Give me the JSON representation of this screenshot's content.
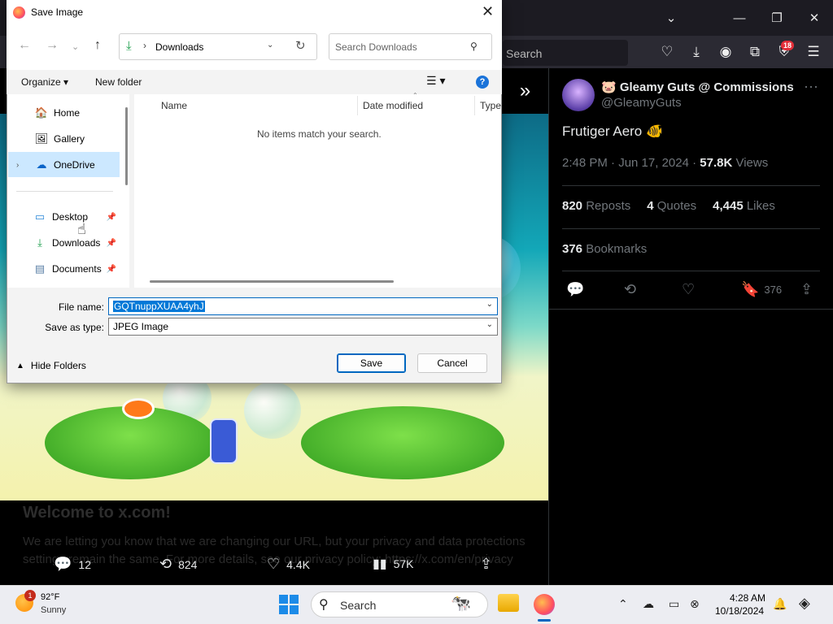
{
  "browser": {
    "search_placeholder": "Search",
    "extension_badge": "18"
  },
  "left": {
    "welcome_title": "Welcome to x.com!",
    "welcome_body": "We are letting you know that we are changing our URL, but your privacy and data protections settings remain the same. For more details, see our privacy policy: https://x.com/en/privacy",
    "actions": {
      "replies": "12",
      "reposts": "824",
      "likes": "4.4K",
      "views": "57K"
    }
  },
  "tweet": {
    "author_name": "🐷 Gleamy Guts @ Commissions ?",
    "author_handle": "@GleamyGuts",
    "text": "Frutiger Aero 🐠",
    "time": "2:48 PM · Jun 17, 2024 ·",
    "views_count": "57.8K",
    "views_label": "Views",
    "reposts_count": "820",
    "reposts_label": "Reposts",
    "quotes_count": "4",
    "quotes_label": "Quotes",
    "likes_count": "4,445",
    "likes_label": "Likes",
    "bookmarks_count": "376",
    "bookmarks_label": "Bookmarks",
    "bookmark_action_count": "376"
  },
  "dialog": {
    "title": "Save Image",
    "address": "Downloads",
    "search_placeholder": "Search Downloads",
    "organize": "Organize ▾",
    "new_folder": "New folder",
    "nav_items": [
      {
        "label": "Home"
      },
      {
        "label": "Gallery"
      },
      {
        "label": "OneDrive"
      },
      {
        "label": "Desktop"
      },
      {
        "label": "Downloads"
      },
      {
        "label": "Documents"
      }
    ],
    "columns": [
      "Name",
      "Date modified",
      "Type"
    ],
    "empty_message": "No items match your search.",
    "file_name_label": "File name:",
    "file_name_value": "GQTnuppXUAA4yhJ",
    "save_type_label": "Save as type:",
    "save_type_value": "JPEG Image",
    "hide_folders": "Hide Folders",
    "save": "Save",
    "cancel": "Cancel"
  },
  "taskbar": {
    "weather_badge": "1",
    "temperature": "92°F",
    "condition": "Sunny",
    "search_label": "Search",
    "time": "4:28 AM",
    "date": "10/18/2024"
  },
  "colors": {
    "accent": "#0067c0",
    "selection": "#0078d7",
    "x_background": "#000000"
  }
}
